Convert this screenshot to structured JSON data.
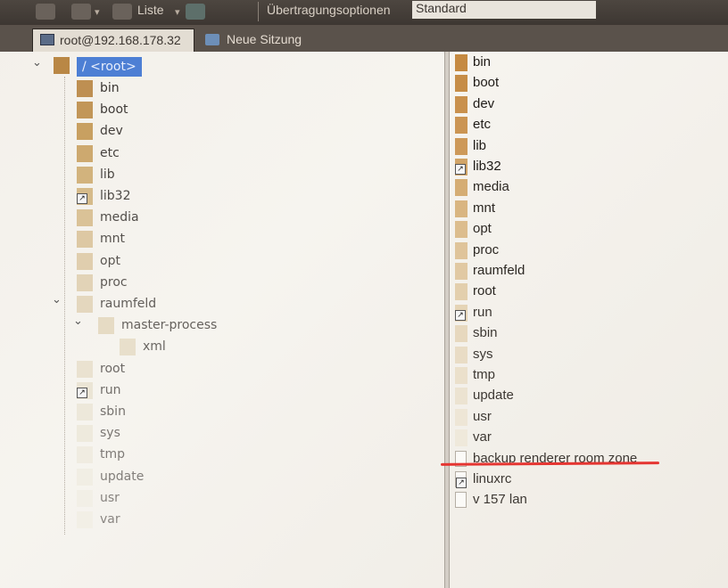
{
  "toolbar": {
    "liste_label": "Liste",
    "transfer_label": "Übertragungsoptionen",
    "transfer_value": "Standard"
  },
  "tabs": {
    "host": "root@192.168.178.32",
    "new_session": "Neue Sitzung"
  },
  "tree": {
    "root": "/ <root>",
    "children": [
      "bin",
      "boot",
      "dev",
      "etc",
      "lib",
      "lib32",
      "media",
      "mnt",
      "opt",
      "proc",
      "raumfeld",
      "master-process",
      "xml",
      "root",
      "run",
      "sbin",
      "sys",
      "tmp",
      "update",
      "usr",
      "var"
    ]
  },
  "files": {
    "items": [
      "bin",
      "boot",
      "dev",
      "etc",
      "lib",
      "lib32",
      "media",
      "mnt",
      "opt",
      "proc",
      "raumfeld",
      "root",
      "run",
      "sbin",
      "sys",
      "tmp",
      "update",
      "usr",
      "var",
      "backup renderer room zone",
      "linuxrc",
      "v 157 lan"
    ]
  },
  "colors": {
    "selection": "#4d7fd4",
    "annotation_underline": "#e53531"
  },
  "icons": [
    "folder-icon",
    "symlink-folder-icon",
    "file-icon",
    "symlink-file-icon",
    "chevron-down-icon",
    "monitor-icon",
    "new-session-icon"
  ]
}
